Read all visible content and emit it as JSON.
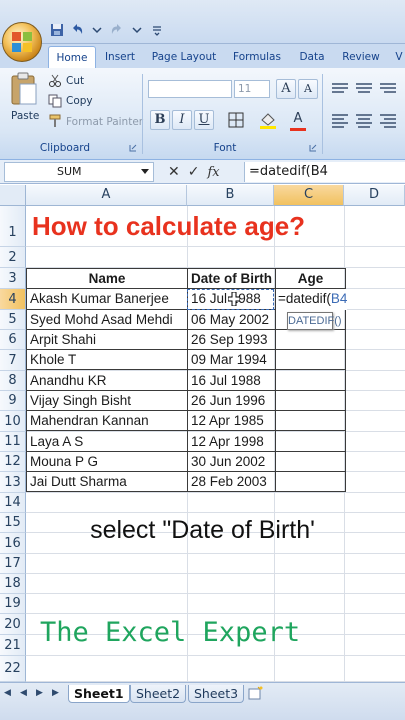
{
  "ribbon_tabs": [
    "Home",
    "Insert",
    "Page Layout",
    "Formulas",
    "Data",
    "Review",
    "V"
  ],
  "clipboard": {
    "paste": "Paste",
    "cut": "Cut",
    "copy": "Copy",
    "format_painter": "Format Painter",
    "label": "Clipboard"
  },
  "font_group": {
    "size": "11",
    "bold": "B",
    "italic": "I",
    "underline": "U",
    "grow": "A",
    "label": "Font"
  },
  "formula_bar": {
    "name_box": "SUM",
    "fx": "fx",
    "content": "=datedif(B4"
  },
  "columns": [
    "A",
    "B",
    "C",
    "D"
  ],
  "rows": [
    "1",
    "2",
    "3",
    "4",
    "5",
    "6",
    "7",
    "8",
    "9",
    "10",
    "11",
    "12",
    "13",
    "14",
    "15",
    "16",
    "17",
    "18",
    "19",
    "20",
    "21",
    "22"
  ],
  "title": "How to calculate age?",
  "table": {
    "headers": [
      "Name",
      "Date of Birth",
      "Age"
    ],
    "rows": [
      [
        "Akash Kumar Banerjee",
        "16 Jul 1988"
      ],
      [
        "Syed Mohd Asad Mehdi",
        "06 May 2002"
      ],
      [
        "Arpit Shahi",
        "26 Sep 1993"
      ],
      [
        "Khole T",
        "09 Mar 1994"
      ],
      [
        "Anandhu KR",
        "16 Jul 1988"
      ],
      [
        "Vijay Singh Bisht",
        "26 Jun 1996"
      ],
      [
        "Mahendran Kannan",
        "12 Apr 1985"
      ],
      [
        "Laya A S",
        "12 Apr 1998"
      ],
      [
        "Mouna P G",
        "30 Jun 2002"
      ],
      [
        "Jai Dutt Sharma",
        "28 Feb 2003"
      ]
    ]
  },
  "editing": {
    "formula_prefix": "=datedif(",
    "formula_ref": "B4",
    "tooltip": "DATEDIF()"
  },
  "caption": "select \"Date of Birth'",
  "watermark": "The Excel Expert",
  "sheet_tabs": [
    "Sheet1",
    "Sheet2",
    "Sheet3"
  ],
  "colors": {
    "title": "#e8321e",
    "watermark": "#1fa55e",
    "selection": "#f1c15f",
    "ribbon": "#c9daf0"
  }
}
